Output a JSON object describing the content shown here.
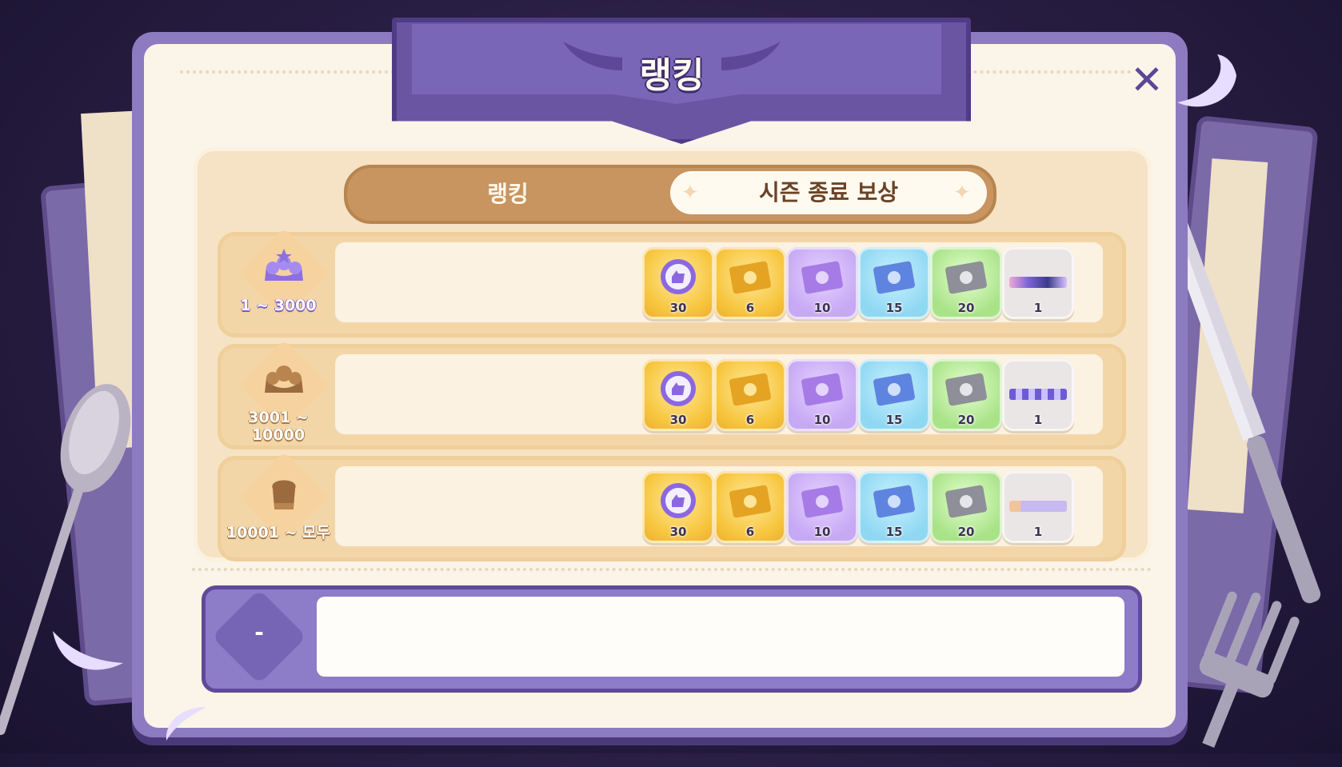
{
  "header": {
    "title": "랭킹",
    "close_label": "✕"
  },
  "tabs": [
    {
      "label": "랭킹",
      "active": false
    },
    {
      "label": "시즌 종료 보상",
      "active": true
    }
  ],
  "reward_rows": [
    {
      "range": "1 ~ 3000",
      "tier_icon": "purple-crown-icon",
      "rewards": [
        {
          "icon": "thumbs-up-medal-icon",
          "qty": "30"
        },
        {
          "icon": "gold-ticket-icon",
          "qty": "6"
        },
        {
          "icon": "purple-ticket-icon",
          "qty": "10"
        },
        {
          "icon": "blue-ticket-icon",
          "qty": "15"
        },
        {
          "icon": "silver-ticket-icon",
          "qty": "20"
        },
        {
          "icon": "banner-strip-icon",
          "qty": "1"
        }
      ]
    },
    {
      "range": "3001 ~ 10000",
      "tier_icon": "brown-crown-icon",
      "rewards": [
        {
          "icon": "thumbs-up-medal-icon",
          "qty": "30"
        },
        {
          "icon": "gold-ticket-icon",
          "qty": "6"
        },
        {
          "icon": "purple-ticket-icon",
          "qty": "10"
        },
        {
          "icon": "blue-ticket-icon",
          "qty": "15"
        },
        {
          "icon": "silver-ticket-icon",
          "qty": "20"
        },
        {
          "icon": "banner-strip-icon",
          "qty": "1"
        }
      ]
    },
    {
      "range": "10001 ~ 모두",
      "tier_icon": "chef-hat-icon",
      "rewards": [
        {
          "icon": "thumbs-up-medal-icon",
          "qty": "30"
        },
        {
          "icon": "gold-ticket-icon",
          "qty": "6"
        },
        {
          "icon": "purple-ticket-icon",
          "qty": "10"
        },
        {
          "icon": "blue-ticket-icon",
          "qty": "15"
        },
        {
          "icon": "silver-ticket-icon",
          "qty": "20"
        },
        {
          "icon": "banner-strip-icon",
          "qty": "1"
        }
      ]
    }
  ],
  "my_rank": {
    "value": "-"
  },
  "colors": {
    "frame": "#8c7bc0",
    "banner": "#6a55a3",
    "tab_bar": "#c8945f",
    "row": "#f3d6a8"
  }
}
